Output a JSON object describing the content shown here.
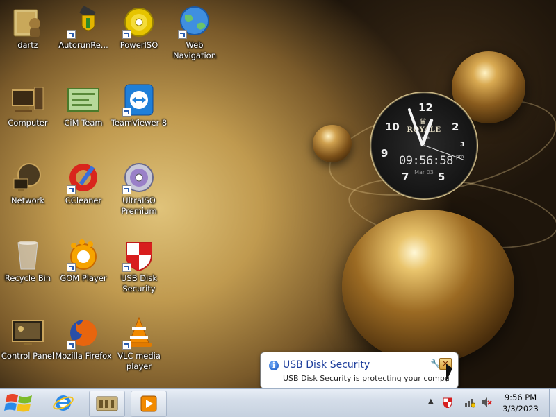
{
  "desktop": {
    "icons": [
      {
        "label": "dartz",
        "icon": "user-folder-icon"
      },
      {
        "label": "AutorunRe...",
        "icon": "autorun-remover-icon"
      },
      {
        "label": "PowerISO",
        "icon": "poweriso-disc-icon"
      },
      {
        "label": "Web\nNavigation",
        "icon": "globe-icon"
      },
      {
        "label": "Computer",
        "icon": "computer-icon"
      },
      {
        "label": "CiM Team",
        "icon": "cim-team-icon"
      },
      {
        "label": "TeamViewer 8",
        "icon": "teamviewer-icon"
      },
      {
        "label": "Network",
        "icon": "network-icon"
      },
      {
        "label": "CCleaner",
        "icon": "ccleaner-icon"
      },
      {
        "label": "UltraISO\nPremium",
        "icon": "ultraiso-icon"
      },
      {
        "label": "Recycle Bin",
        "icon": "recycle-bin-icon"
      },
      {
        "label": "GOM Player",
        "icon": "gom-player-icon"
      },
      {
        "label": "USB Disk\nSecurity",
        "icon": "usb-disk-security-icon"
      },
      {
        "label": "Control Panel",
        "icon": "control-panel-icon"
      },
      {
        "label": "Mozilla Firefox",
        "icon": "firefox-icon"
      },
      {
        "label": "VLC media\nplayer",
        "icon": "vlc-icon"
      }
    ]
  },
  "clock_gadget": {
    "brand": "ROYALE",
    "sub": "clock",
    "numerals": [
      "12",
      "2",
      "3",
      "5",
      "7",
      "9",
      "10"
    ],
    "digital_time": "09:56:58",
    "ampm": "pm",
    "date": "Mar 03"
  },
  "notification": {
    "title": "USB Disk Security",
    "message": "USB Disk Security is protecting your computer",
    "icon": "info-icon"
  },
  "taskbar": {
    "pinned": [
      {
        "name": "internet-explorer",
        "icon": "internet-explorer-icon"
      },
      {
        "name": "library",
        "icon": "library-icon"
      },
      {
        "name": "media-player",
        "icon": "media-player-icon"
      }
    ],
    "tray_icons": [
      "usb-disk-security-tray-icon",
      "network-tray-icon",
      "volume-muted-tray-icon"
    ],
    "time": "9:56 PM",
    "date": "3/3/2023"
  }
}
